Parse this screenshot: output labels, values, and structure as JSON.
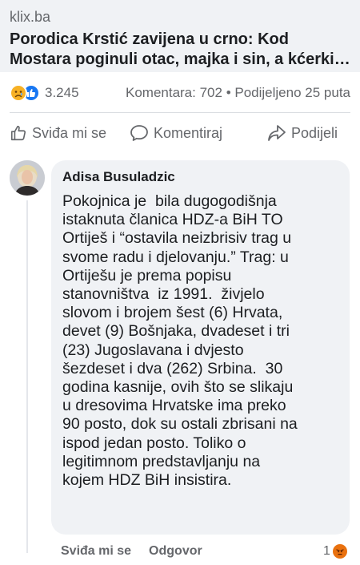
{
  "link_preview": {
    "domain": "klix.ba",
    "headline_line1": "Porodica Krstić zavijena u crno: Kod",
    "headline_line2": "Mostara poginuli otac, majka i sin, a kćerki…"
  },
  "stats": {
    "reaction_icons": [
      "sad-icon",
      "like-icon"
    ],
    "reaction_count": "3.245",
    "comments": "Komentara: 702",
    "separator": "•",
    "shares": "Podijeljeno 25 puta"
  },
  "actions": {
    "like": "Sviđa mi se",
    "comment": "Komentiraj",
    "share": "Podijeli"
  },
  "comment": {
    "author": "Adisa Busuladzic",
    "lines": [
      "Pokojnica je  bila dugogodišnja",
      "istaknuta članica HDZ-a BiH TO",
      "Ortiješ i “ostavila neizbrisiv trag u",
      "svome radu i djelovanju.” Trag: u",
      "Ortiješu je prema popisu",
      "stanovništva  iz 1991.  živjelo",
      "slovom i brojem šest (6) Hrvata,",
      "devet (9) Bošnjaka, dvadeset i tri",
      "(23) Jugoslavana i dvjesto",
      "šezdeset i dva (262) Srbina.  30",
      "godina kasnije, ovih što se slikaju",
      "u dresovima Hrvatske ima preko",
      "90 posto, dok su ostali zbrisani na",
      "ispod jedan posto. Toliko o",
      "legitimnom predstavljanju na",
      "kojem HDZ BiH insistira."
    ],
    "like_label": "Sviđa mi se",
    "reply_label": "Odgovor",
    "reaction_count": "1",
    "reaction_icon": "angry-icon"
  },
  "colors": {
    "secondary_text": "#65676b",
    "bubble_bg": "#f0f2f5",
    "like_blue": "#1877f2",
    "sad_yellow": "#f7b125",
    "angry_orange": "#e9710f"
  }
}
